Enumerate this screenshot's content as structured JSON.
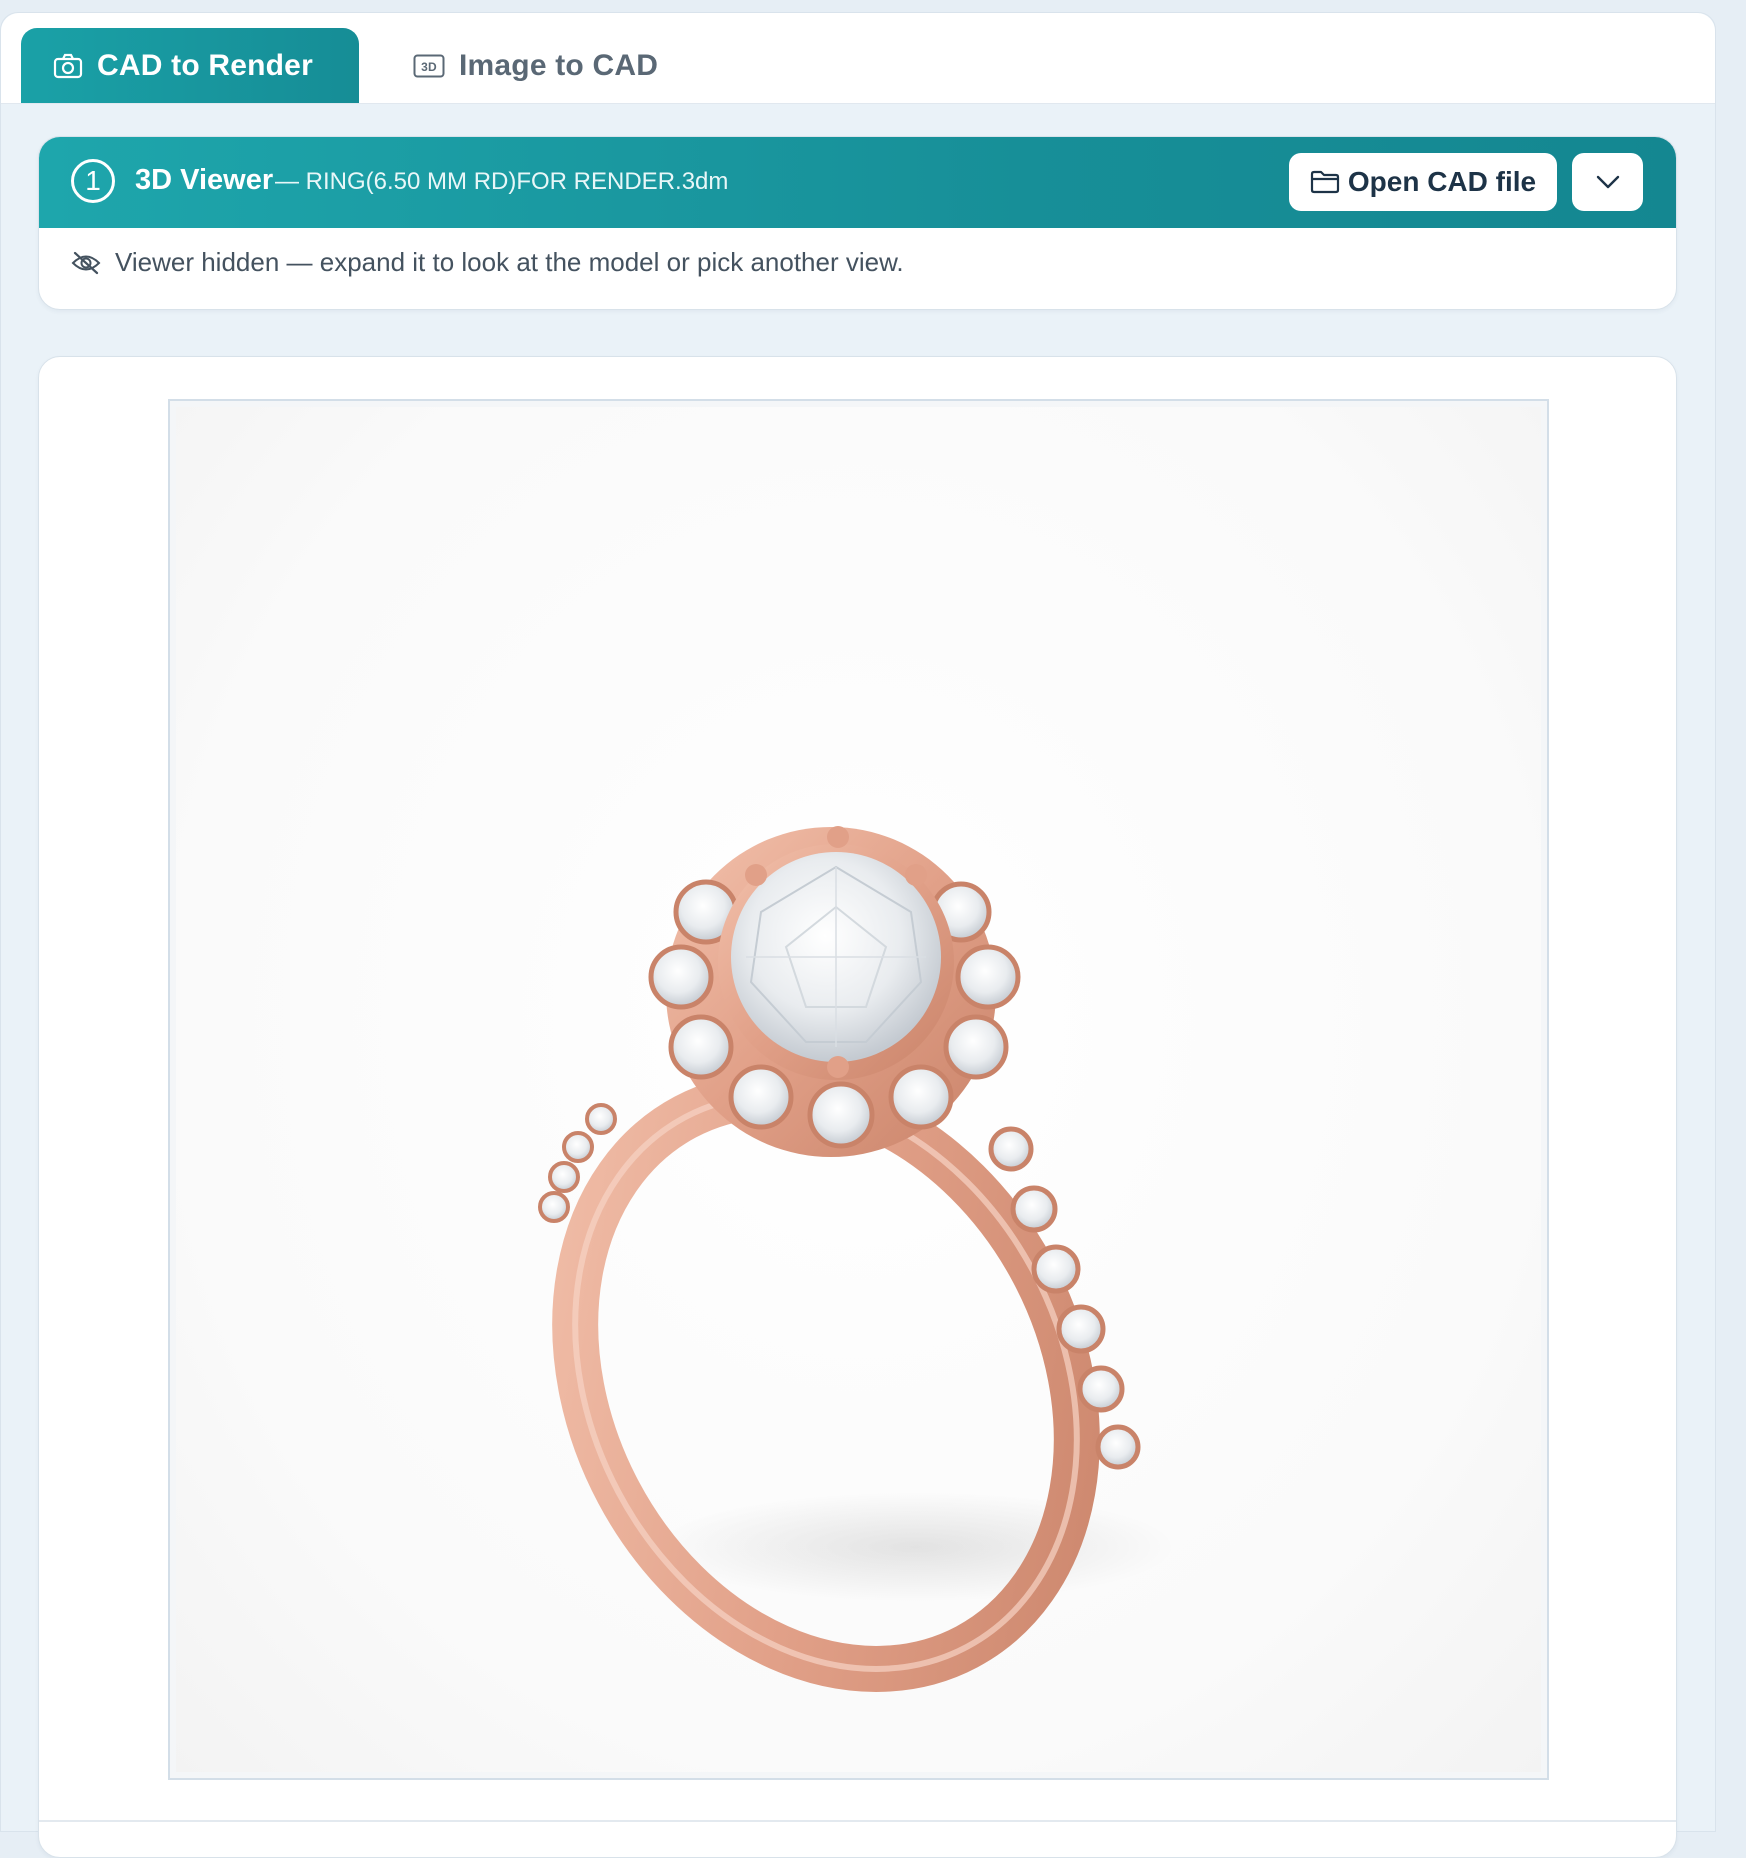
{
  "tabs": [
    {
      "label": "CAD to Render",
      "icon": "camera-icon",
      "active": true
    },
    {
      "label": "Image to CAD",
      "icon": "3d-box-icon",
      "active": false
    }
  ],
  "icon_3d_text": "3D",
  "viewer": {
    "step": "1",
    "title": "3D Viewer",
    "filename": "— RING(6.50 MM RD)FOR RENDER.3dm",
    "open_button": "Open CAD file",
    "open_button_icon": "folder-icon",
    "dropdown_icon": "chevron-down-icon",
    "hidden_message": "Viewer hidden — expand it to look at the model or pick another view.",
    "hidden_icon": "eye-off-icon"
  },
  "render": {
    "subject": "rose gold halo engagement ring render"
  },
  "colors": {
    "accent": "#1aa1a7",
    "accent_dark": "#148791",
    "background": "#eaf2f8",
    "rose_gold": "#e3a58f"
  }
}
